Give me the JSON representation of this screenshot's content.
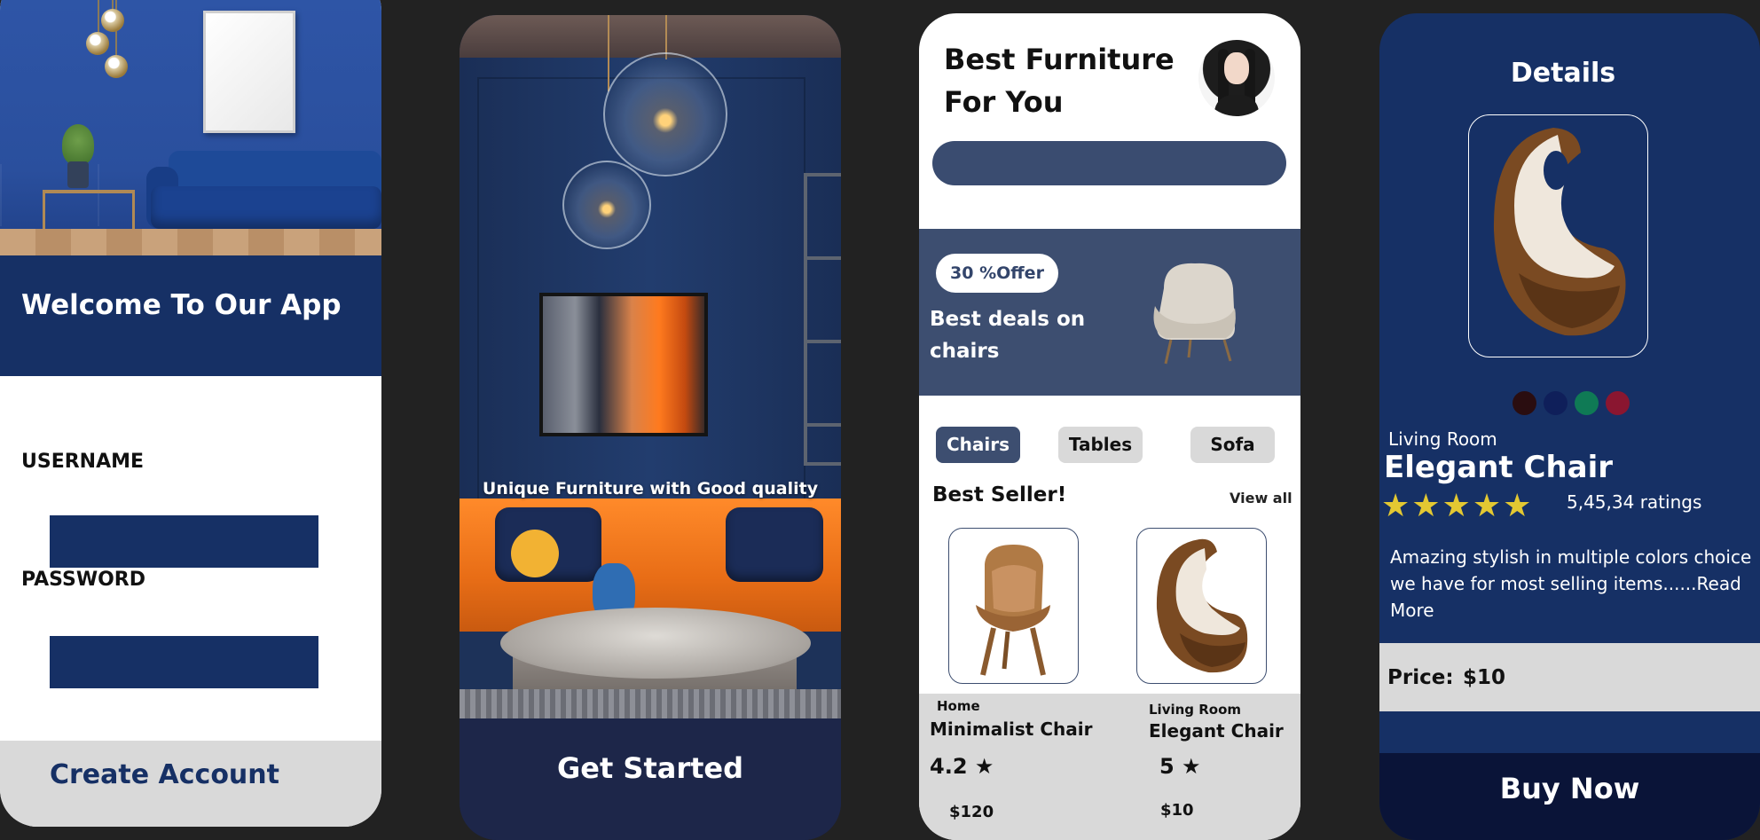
{
  "welcome_screen": {
    "title": "Welcome To Our App",
    "username_label": "USERNAME",
    "password_label": "PASSWORD",
    "create_account": "Create Account"
  },
  "start_screen": {
    "tagline": "Unique Furniture with Good quality",
    "cta": "Get Started"
  },
  "home_screen": {
    "title_line1": "Best Furniture",
    "title_line2": "For You",
    "offer_badge": "30 %Offer",
    "deal_text": "Best deals on chairs",
    "categories": [
      "Chairs",
      "Tables",
      "Sofa"
    ],
    "selected_category": "Chairs",
    "section_title": "Best Seller!",
    "view_all": "View all",
    "products": [
      {
        "category": "Home",
        "name": "Minimalist Chair",
        "rating": "4.2 ★",
        "price": "$120"
      },
      {
        "category": "Living Room",
        "name": "Elegant Chair",
        "rating": "5 ★",
        "price": "$10"
      }
    ]
  },
  "details_screen": {
    "title": "Details",
    "colors": [
      "#2a0d10",
      "#0f1f5a",
      "#0f7a55",
      "#8a1630"
    ],
    "category": "Living Room",
    "name": "Elegant Chair",
    "stars": "★★★★★",
    "ratings": "5,45,34 ratings",
    "description": "Amazing stylish in multiple colors choice we have for most selling items......Read More",
    "price_label": "Price:",
    "price_value": "$10",
    "buy": "Buy Now"
  },
  "colors": {
    "navy": "#163065",
    "slate": "#3d4e70",
    "dark_navy": "#1d2649",
    "light_grey": "#d9d9d9",
    "star_gold": "#e3c832"
  }
}
